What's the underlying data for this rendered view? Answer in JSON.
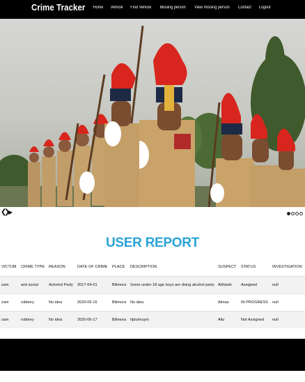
{
  "header": {
    "brand": "Crime Tracker",
    "nav": [
      "Home",
      "Vehicle",
      "Find Vehicle",
      "Missing person",
      "View missing person",
      "Contact",
      "Logout"
    ]
  },
  "slider": {
    "prev_icon": "chevron-left-icon",
    "next_icon": "chevron-right-icon",
    "play_icon": "play-icon",
    "slide_count": 4,
    "active_slide": 1
  },
  "report": {
    "title": "USER REPORT",
    "columns": [
      "VICTUM",
      "CRIME TYPE",
      "REASON",
      "DATE OF CRIME",
      "PLACE",
      "DESCRIPTION",
      "SUSPECT",
      "STATUS",
      "INVESTIGATION"
    ],
    "rows": [
      [
        "zam",
        "anti social",
        "Achohol Party",
        "2017-04-01",
        "Bilimora",
        "Some under 18 age boys are doing alcohol party",
        "Abhisek",
        "Assigned",
        "null"
      ],
      [
        "zam",
        "robbery",
        "No idea",
        "2020-06-16",
        "Bilimora",
        "No idea",
        "Almas",
        "IN PROGRESS",
        "null"
      ],
      [
        "zam",
        "robbery",
        "No idea",
        "2020-06-17",
        "Bilimora",
        "hjbuhvuyni",
        "Allu",
        "Not Assigned",
        "null"
      ]
    ]
  },
  "colors": {
    "topbar": "#000000",
    "title_accent": "#29a3d6",
    "footer": "#000000",
    "plume_red": "#d8261e",
    "uniform_khaki": "#c9a36a"
  }
}
